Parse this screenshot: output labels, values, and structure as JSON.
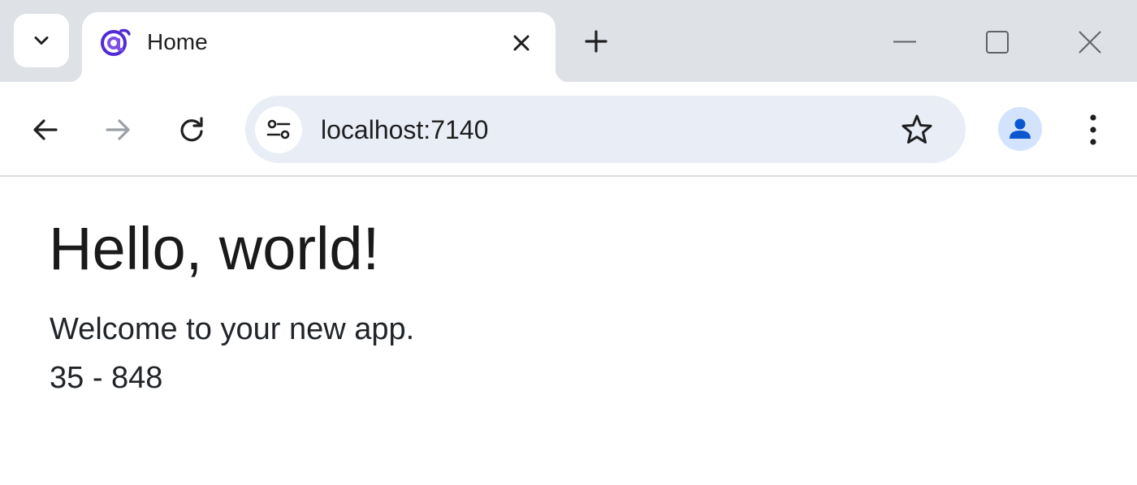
{
  "browser": {
    "tab": {
      "title": "Home"
    },
    "address_bar": {
      "url": "localhost:7140"
    }
  },
  "icons": {
    "tab_search": "chevron-down-icon",
    "favicon": "blazor-icon",
    "tab_close": "close-icon",
    "new_tab": "plus-icon",
    "minimize": "minimize-icon",
    "maximize": "maximize-icon",
    "close_window": "close-icon",
    "back": "arrow-left-icon",
    "forward": "arrow-right-icon",
    "reload": "reload-icon",
    "site_info": "tune-icon",
    "bookmark": "star-icon",
    "profile": "person-icon",
    "menu": "more-vert-icon"
  },
  "colors": {
    "tabstrip_bg": "#dee1e6",
    "omnibox_bg": "#e9edf6",
    "favicon_purple": "#512bd4",
    "profile_blue": "#0b57d0"
  },
  "page": {
    "heading": "Hello, world!",
    "welcome": "Welcome to your new app.",
    "counter": "35 - 848"
  }
}
